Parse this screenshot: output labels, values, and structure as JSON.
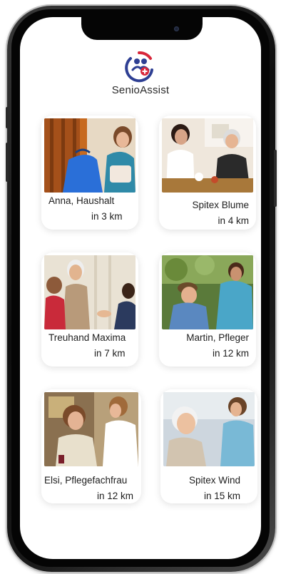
{
  "app": {
    "name": "SenioAssist"
  },
  "colors": {
    "brand_blue": "#2e3f93",
    "brand_red": "#d8263a",
    "text": "#1e1e1e"
  },
  "providers": [
    {
      "name": "Anna, Haushalt",
      "distance": "in 3 km"
    },
    {
      "name": "Spitex Blume",
      "distance": "in 4 km"
    },
    {
      "name": "Treuhand Maxima",
      "distance": "in 7 km"
    },
    {
      "name": "Martin, Pfleger",
      "distance": "in 12 km"
    },
    {
      "name": "Elsi, Pflegefachfrau",
      "distance": "in 12 km"
    },
    {
      "name": "Spitex Wind",
      "distance": "in 15 km"
    }
  ]
}
